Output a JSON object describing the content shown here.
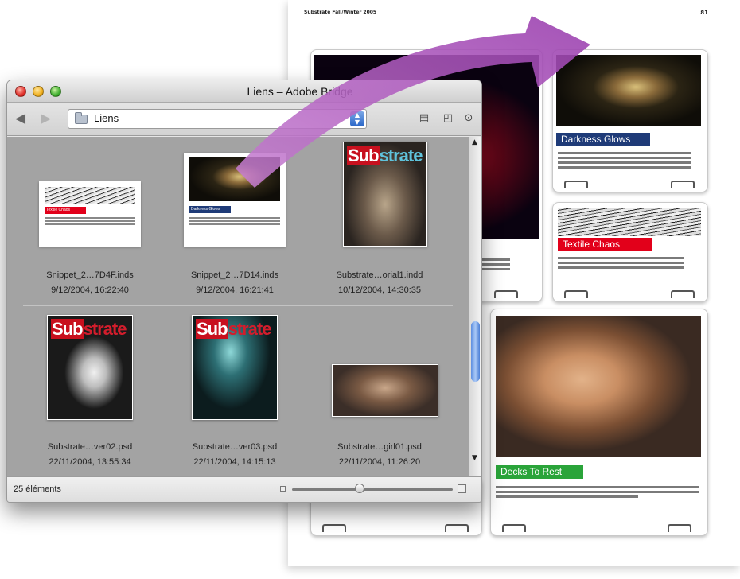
{
  "layout_page": {
    "header": "Substrate Fall/Winter 2005",
    "page_number": "81",
    "cards": [
      {
        "tag": "Darkness Glows",
        "tag_color": "#1f3b78"
      },
      {
        "tag": "Textile Chaos",
        "tag_color": "#e2001a"
      },
      {
        "tag": "Decks To Rest",
        "tag_color": "#2aa43a"
      }
    ]
  },
  "window": {
    "title": "Liens – Adobe Bridge",
    "path_label": "Liens",
    "status": "25 éléments",
    "zoom_level": 0.42,
    "thumbnails": [
      {
        "name": "Snippet_2…7D4F.inds",
        "date": "9/12/2004, 16:22:40",
        "label": "Textile Chaos",
        "label_color": "#e2001a"
      },
      {
        "name": "Snippet_2…7D14.inds",
        "date": "9/12/2004, 16:21:41",
        "label": "Darkness Glows",
        "label_color": "#1f3b78"
      },
      {
        "name": "Substrate…orial1.indd",
        "date": "10/12/2004, 14:30:35",
        "cover_a": "Sub",
        "cover_b": "strate"
      },
      {
        "name": "Substrate…ver02.psd",
        "date": "22/11/2004, 13:55:34",
        "cover_a": "Sub",
        "cover_b": "strate"
      },
      {
        "name": "Substrate…ver03.psd",
        "date": "22/11/2004, 14:15:13",
        "cover_a": "Sub",
        "cover_b": "strate"
      },
      {
        "name": "Substrate…girl01.psd",
        "date": "22/11/2004, 11:26:20"
      }
    ]
  },
  "colors": {
    "arrow": "#b35cc0",
    "content_bg": "#a3a3a3",
    "scroll_accent": "#4b7fd6"
  },
  "icons": [
    "back-arrow-icon",
    "forward-arrow-icon",
    "folder-icon",
    "path-stepper-icon",
    "panel-toggle-icon",
    "compact-mode-icon",
    "play-menu-icon",
    "scroll-up-icon",
    "scroll-down-icon",
    "zoom-small-icon",
    "zoom-large-icon"
  ]
}
